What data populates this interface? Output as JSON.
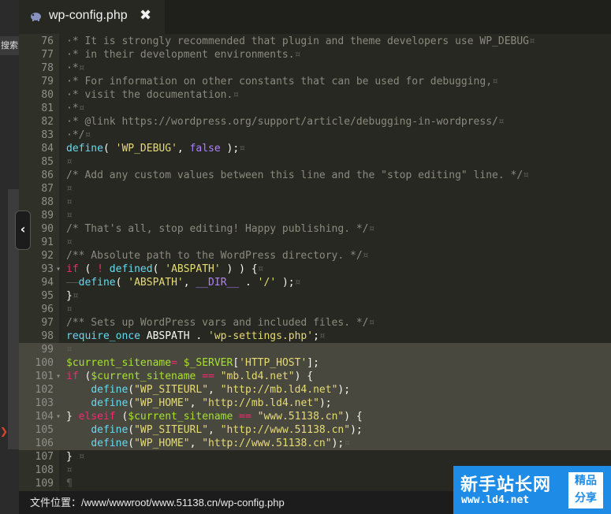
{
  "tab": {
    "title": "wp-config.php",
    "icon": "php-elephant-icon",
    "close": "✖"
  },
  "left_panel": {
    "search_label": "搜索"
  },
  "status": {
    "path": "文件位置：/www/wwwroot/www.51138.cn/wp-config.php"
  },
  "watermark": {
    "title": "新手站长网",
    "url": "www.ld4.net",
    "badge_line1": "精品",
    "badge_line2": "分享"
  },
  "colors": {
    "background": "#272822",
    "comment": "#8a8a7d",
    "keyword": "#f92672",
    "string": "#e6db74",
    "function": "#66d9ef",
    "constant": "#ae81ff",
    "variable": "#a6e22e",
    "selection": "#49483e"
  },
  "code_lines": [
    {
      "n": "76",
      "fold": "",
      "sel": false,
      "segs": [
        [
          "c",
          "·* It is strongly recommended that plugin and theme developers use WP_DEBUG"
        ],
        [
          "w",
          "¤"
        ]
      ]
    },
    {
      "n": "77",
      "fold": "",
      "sel": false,
      "segs": [
        [
          "c",
          "·* in their development environments."
        ],
        [
          "w",
          "¤"
        ]
      ]
    },
    {
      "n": "78",
      "fold": "",
      "sel": false,
      "segs": [
        [
          "c",
          "·*"
        ],
        [
          "w",
          "¤"
        ]
      ]
    },
    {
      "n": "79",
      "fold": "",
      "sel": false,
      "segs": [
        [
          "c",
          "·* For information on other constants that can be used for debugging,"
        ],
        [
          "w",
          "¤"
        ]
      ]
    },
    {
      "n": "80",
      "fold": "",
      "sel": false,
      "segs": [
        [
          "c",
          "·* visit the documentation."
        ],
        [
          "w",
          "¤"
        ]
      ]
    },
    {
      "n": "81",
      "fold": "",
      "sel": false,
      "segs": [
        [
          "c",
          "·*"
        ],
        [
          "w",
          "¤"
        ]
      ]
    },
    {
      "n": "82",
      "fold": "",
      "sel": false,
      "segs": [
        [
          "c",
          "·* @link https://wordpress.org/support/article/debugging-in-wordpress/"
        ],
        [
          "w",
          "¤"
        ]
      ]
    },
    {
      "n": "83",
      "fold": "",
      "sel": false,
      "segs": [
        [
          "c",
          "·*/"
        ],
        [
          "w",
          "¤"
        ]
      ]
    },
    {
      "n": "84",
      "fold": "",
      "sel": false,
      "segs": [
        [
          "f",
          "define"
        ],
        [
          "p",
          "( "
        ],
        [
          "s",
          "'WP_DEBUG'"
        ],
        [
          "p",
          ", "
        ],
        [
          "b",
          "false"
        ],
        [
          "p",
          " );"
        ],
        [
          "w",
          "¤"
        ]
      ]
    },
    {
      "n": "85",
      "fold": "",
      "sel": false,
      "segs": [
        [
          "w",
          "¤"
        ]
      ]
    },
    {
      "n": "86",
      "fold": "",
      "sel": false,
      "segs": [
        [
          "c",
          "/* Add any custom values between this line and the \"stop editing\" line. */"
        ],
        [
          "w",
          "¤"
        ]
      ]
    },
    {
      "n": "87",
      "fold": "",
      "sel": false,
      "segs": [
        [
          "w",
          "¤"
        ]
      ]
    },
    {
      "n": "88",
      "fold": "",
      "sel": false,
      "segs": [
        [
          "w",
          "¤"
        ]
      ]
    },
    {
      "n": "89",
      "fold": "",
      "sel": false,
      "segs": [
        [
          "w",
          "¤"
        ]
      ]
    },
    {
      "n": "90",
      "fold": "",
      "sel": false,
      "segs": [
        [
          "c",
          "/* That's all, stop editing! Happy publishing. */"
        ],
        [
          "w",
          "¤"
        ]
      ]
    },
    {
      "n": "91",
      "fold": "",
      "sel": false,
      "segs": [
        [
          "w",
          "¤"
        ]
      ]
    },
    {
      "n": "92",
      "fold": "",
      "sel": false,
      "segs": [
        [
          "c",
          "/** Absolute path to the WordPress directory. */"
        ],
        [
          "w",
          "¤"
        ]
      ]
    },
    {
      "n": "93",
      "fold": "▾",
      "sel": false,
      "segs": [
        [
          "k",
          "if"
        ],
        [
          "p",
          " ( "
        ],
        [
          "k",
          "!"
        ],
        [
          "p",
          " "
        ],
        [
          "f",
          "defined"
        ],
        [
          "p",
          "( "
        ],
        [
          "s",
          "'ABSPATH'"
        ],
        [
          "p",
          " ) ) {"
        ],
        [
          "w",
          "¤"
        ]
      ]
    },
    {
      "n": "94",
      "fold": "",
      "sel": false,
      "segs": [
        [
          "w",
          "——"
        ],
        [
          "f",
          "define"
        ],
        [
          "p",
          "( "
        ],
        [
          "s",
          "'ABSPATH'"
        ],
        [
          "p",
          ", "
        ],
        [
          "b",
          "__DIR__"
        ],
        [
          "p",
          " . "
        ],
        [
          "s",
          "'/'"
        ],
        [
          "p",
          " );"
        ],
        [
          "w",
          "¤"
        ]
      ]
    },
    {
      "n": "95",
      "fold": "",
      "sel": false,
      "segs": [
        [
          "p",
          "}"
        ],
        [
          "w",
          "¤"
        ]
      ]
    },
    {
      "n": "96",
      "fold": "",
      "sel": false,
      "segs": [
        [
          "w",
          "¤"
        ]
      ]
    },
    {
      "n": "97",
      "fold": "",
      "sel": false,
      "segs": [
        [
          "c",
          "/** Sets up WordPress vars and included files. */"
        ],
        [
          "w",
          "¤"
        ]
      ]
    },
    {
      "n": "98",
      "fold": "",
      "sel": false,
      "segs": [
        [
          "f",
          "require_once"
        ],
        [
          "p",
          " ABSPATH . "
        ],
        [
          "s",
          "'wp-settings.php'"
        ],
        [
          "p",
          ";"
        ],
        [
          "w",
          "¤"
        ]
      ]
    },
    {
      "n": "99",
      "fold": "",
      "sel": true,
      "segs": [
        [
          "w",
          "¤"
        ]
      ]
    },
    {
      "n": "100",
      "fold": "",
      "sel": true,
      "segs": [
        [
          "v",
          "$current_sitename"
        ],
        [
          "k",
          "="
        ],
        [
          "p",
          " "
        ],
        [
          "v",
          "$_SERVER"
        ],
        [
          "p",
          "["
        ],
        [
          "s",
          "'HTTP_HOST'"
        ],
        [
          "p",
          "];"
        ]
      ]
    },
    {
      "n": "101",
      "fold": "▾",
      "sel": true,
      "segs": [
        [
          "k",
          "if"
        ],
        [
          "p",
          " ("
        ],
        [
          "v",
          "$current_sitename"
        ],
        [
          "p",
          " "
        ],
        [
          "k",
          "=="
        ],
        [
          "p",
          " "
        ],
        [
          "s",
          "\"mb.ld4.net\""
        ],
        [
          "p",
          ") {"
        ]
      ]
    },
    {
      "n": "102",
      "fold": "",
      "sel": true,
      "segs": [
        [
          "p",
          "    "
        ],
        [
          "f",
          "define"
        ],
        [
          "p",
          "("
        ],
        [
          "s",
          "\"WP_SITEURL\""
        ],
        [
          "p",
          ", "
        ],
        [
          "s",
          "\"http://mb.ld4.net\""
        ],
        [
          "p",
          ");"
        ]
      ]
    },
    {
      "n": "103",
      "fold": "",
      "sel": true,
      "segs": [
        [
          "p",
          "    "
        ],
        [
          "f",
          "define"
        ],
        [
          "p",
          "("
        ],
        [
          "s",
          "\"WP_HOME\""
        ],
        [
          "p",
          ", "
        ],
        [
          "s",
          "\"http://mb.ld4.net\""
        ],
        [
          "p",
          ");"
        ]
      ]
    },
    {
      "n": "104",
      "fold": "▾",
      "sel": true,
      "segs": [
        [
          "p",
          "} "
        ],
        [
          "k",
          "elseif"
        ],
        [
          "p",
          " ("
        ],
        [
          "v",
          "$current_sitename"
        ],
        [
          "p",
          " "
        ],
        [
          "k",
          "=="
        ],
        [
          "p",
          " "
        ],
        [
          "s",
          "\"www.51138.cn\""
        ],
        [
          "p",
          ") {"
        ]
      ]
    },
    {
      "n": "105",
      "fold": "",
      "sel": true,
      "segs": [
        [
          "p",
          "    "
        ],
        [
          "f",
          "define"
        ],
        [
          "p",
          "("
        ],
        [
          "s",
          "\"WP_SITEURL\""
        ],
        [
          "p",
          ", "
        ],
        [
          "s",
          "\"http://www.51138.cn\""
        ],
        [
          "p",
          ");"
        ]
      ]
    },
    {
      "n": "106",
      "fold": "",
      "sel": true,
      "segs": [
        [
          "p",
          "    "
        ],
        [
          "f",
          "define"
        ],
        [
          "p",
          "("
        ],
        [
          "s",
          "\"WP_HOME\""
        ],
        [
          "p",
          ", "
        ],
        [
          "s",
          "\"http://www.51138.cn\""
        ],
        [
          "p",
          ");"
        ],
        [
          "w",
          "¤"
        ]
      ]
    },
    {
      "n": "107",
      "fold": "",
      "sel": false,
      "segs": [
        [
          "p",
          "}"
        ],
        [
          "w",
          " ¤"
        ]
      ]
    },
    {
      "n": "108",
      "fold": "",
      "sel": false,
      "segs": [
        [
          "w",
          "¤"
        ]
      ]
    },
    {
      "n": "109",
      "fold": "",
      "sel": false,
      "segs": [
        [
          "w",
          "¶"
        ]
      ]
    }
  ]
}
